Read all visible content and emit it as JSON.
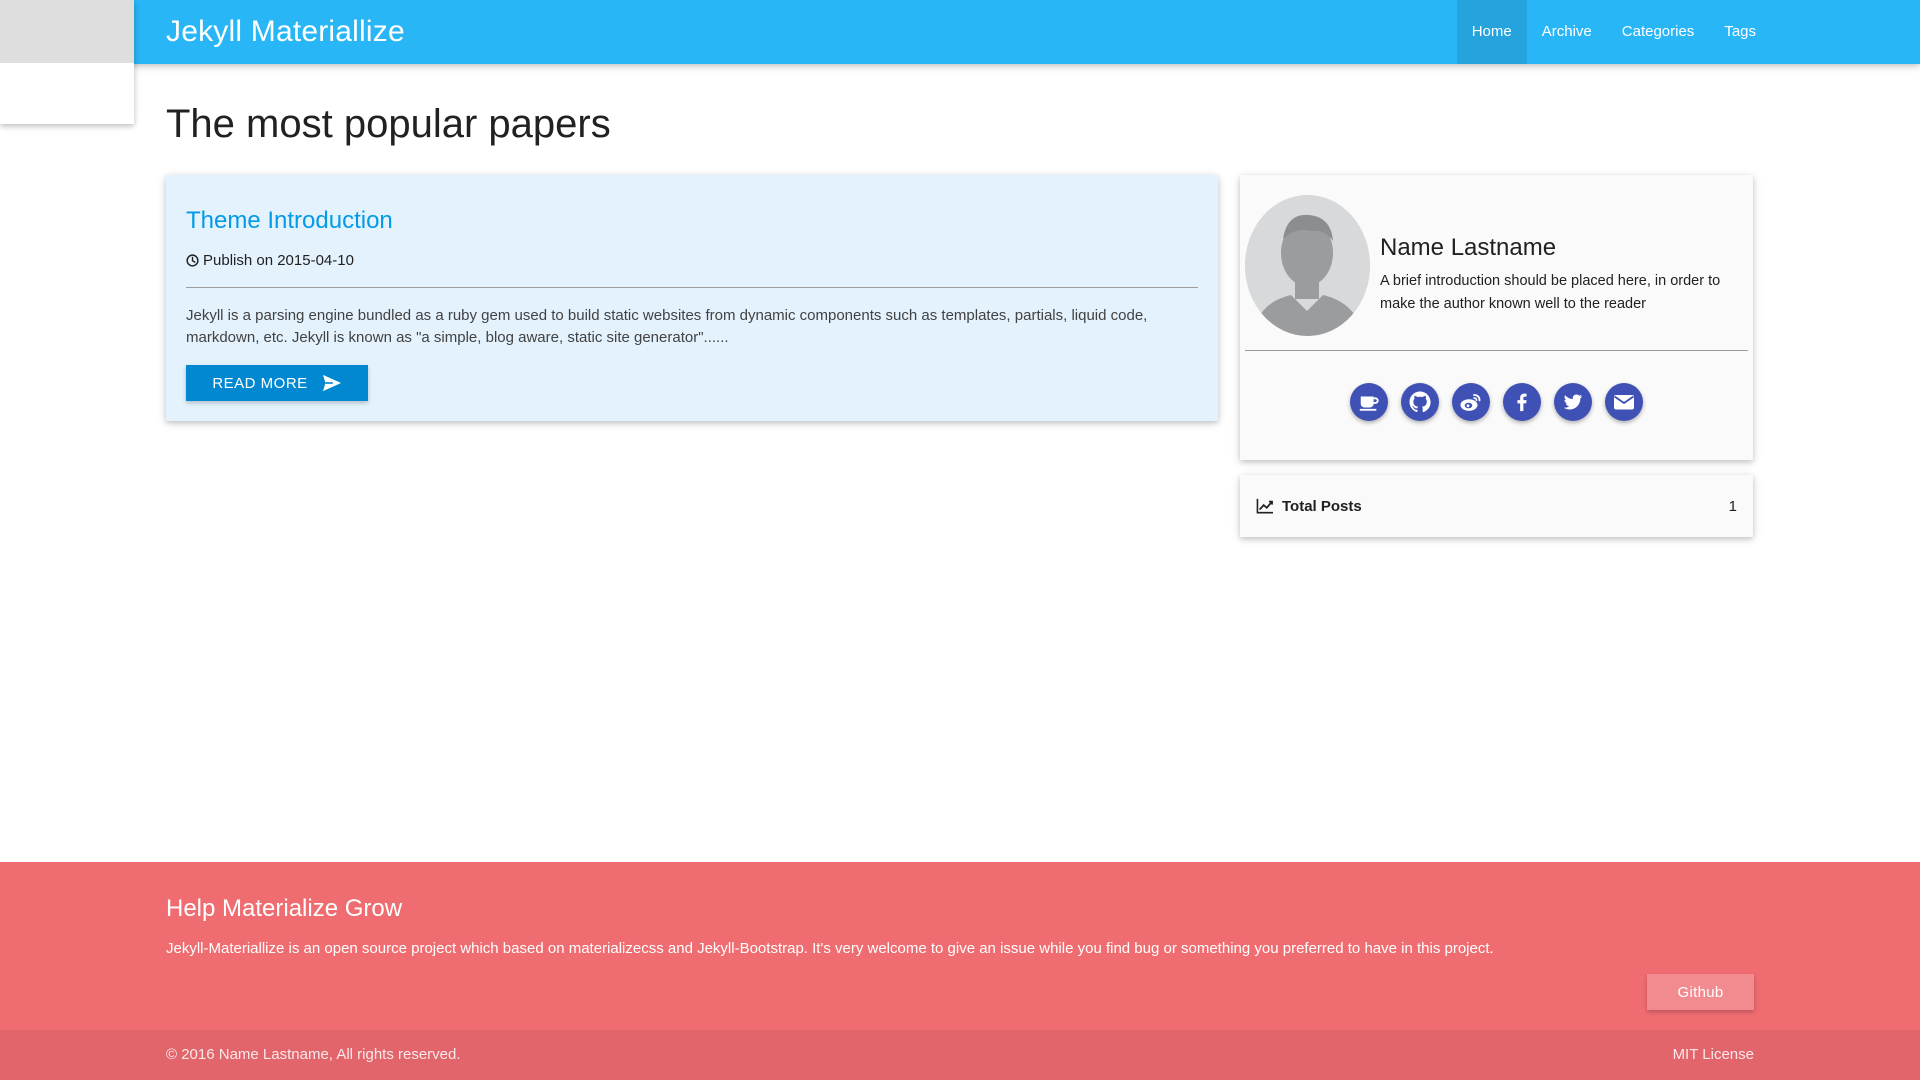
{
  "navbar": {
    "brand": "Jekyll Materiallize",
    "items": [
      {
        "label": "Home",
        "active": true
      },
      {
        "label": "Archive",
        "active": false
      },
      {
        "label": "Categories",
        "active": false
      },
      {
        "label": "Tags",
        "active": false
      }
    ]
  },
  "main": {
    "title": "The most popular papers",
    "post": {
      "title": "Theme Introduction",
      "meta": "Publish on 2015-04-10",
      "excerpt": "Jekyll is a parsing engine bundled as a ruby gem used to build static websites from dynamic components such as templates, partials, liquid code, markdown, etc. Jekyll is known as \"a simple, blog aware, static site generator\"......",
      "read_more_label": "READ MORE"
    }
  },
  "sidebar": {
    "profile": {
      "name": "Name Lastname",
      "bio": "A brief introduction should be placed here, in order to make the author known well to the reader",
      "social": [
        "coffee-icon",
        "github-icon",
        "weibo-icon",
        "facebook-icon",
        "twitter-icon",
        "envelope-icon"
      ]
    },
    "stats": {
      "label": "Total Posts",
      "value": "1"
    }
  },
  "footer": {
    "title": "Help Materialize Grow",
    "text": "Jekyll-Materiallize is an open source project which based on materializecss and Jekyll-Bootstrap. It's very welcome to give an issue while you find bug or something you preferred to have in this project.",
    "button_label": "Github",
    "copyright": "© 2016 Name Lastname, All rights reserved.",
    "license": "MIT License"
  },
  "colors": {
    "navbar": "#29b6f6",
    "post_title": "#039be5",
    "read_more": "#0288d1",
    "social": "#3f51b5",
    "footer": "#ef6c71"
  }
}
